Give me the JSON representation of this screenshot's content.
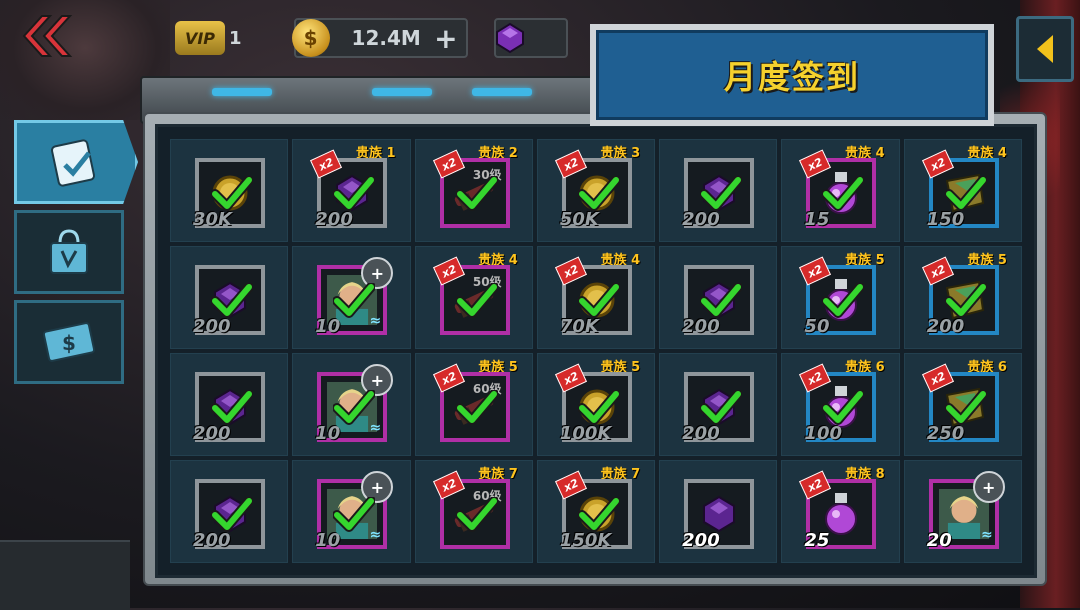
{
  "header": {
    "vip_label": "VIP",
    "vip_level": "1",
    "coin_amount": "12.4M",
    "coin_symbol": "$",
    "plus": "+",
    "title": "月度签到"
  },
  "tabs": [
    {
      "name": "tab-checkin",
      "icon": "calendar-check-icon",
      "active": true
    },
    {
      "name": "tab-shop",
      "icon": "shopping-bag-icon",
      "active": false
    },
    {
      "name": "tab-cash",
      "icon": "cash-icon",
      "active": false
    }
  ],
  "rewards": [
    {
      "qty": "30K",
      "type": "coin",
      "frame": "gray",
      "claimed": true
    },
    {
      "qty": "200",
      "type": "gem",
      "frame": "gray",
      "claimed": true,
      "x2": "x2",
      "noble": "贵族 1"
    },
    {
      "qty": "",
      "type": "weapon",
      "frame": "purple",
      "claimed": true,
      "x2": "x2",
      "noble": "贵族 2",
      "level": "30级"
    },
    {
      "qty": "50K",
      "type": "coin",
      "frame": "gray",
      "claimed": true,
      "x2": "x2",
      "noble": "贵族 3"
    },
    {
      "qty": "200",
      "type": "gem",
      "frame": "gray",
      "claimed": true
    },
    {
      "qty": "15",
      "type": "potion",
      "frame": "purple",
      "claimed": true,
      "x2": "x2",
      "noble": "贵族 4"
    },
    {
      "qty": "150",
      "type": "crystal",
      "frame": "blue",
      "claimed": true,
      "x2": "x2",
      "noble": "贵族 4"
    },
    {
      "qty": "200",
      "type": "gem",
      "frame": "gray",
      "claimed": true
    },
    {
      "qty": "10",
      "type": "hero",
      "frame": "purple",
      "claimed": true,
      "puzzle": "+",
      "wave": "≈"
    },
    {
      "qty": "",
      "type": "weapon",
      "frame": "purple",
      "claimed": true,
      "x2": "x2",
      "noble": "贵族 4",
      "level": "50级"
    },
    {
      "qty": "70K",
      "type": "coin",
      "frame": "gray",
      "claimed": true,
      "x2": "x2",
      "noble": "贵族 4"
    },
    {
      "qty": "200",
      "type": "gem",
      "frame": "gray",
      "claimed": true
    },
    {
      "qty": "50",
      "type": "potion",
      "frame": "blue",
      "claimed": true,
      "x2": "x2",
      "noble": "贵族 5"
    },
    {
      "qty": "200",
      "type": "crystal",
      "frame": "blue",
      "claimed": true,
      "x2": "x2",
      "noble": "贵族 5"
    },
    {
      "qty": "200",
      "type": "gem",
      "frame": "gray",
      "claimed": true
    },
    {
      "qty": "10",
      "type": "hero",
      "frame": "purple",
      "claimed": true,
      "puzzle": "+",
      "wave": "≈"
    },
    {
      "qty": "",
      "type": "weapon",
      "frame": "purple",
      "claimed": true,
      "x2": "x2",
      "noble": "贵族 5",
      "level": "60级"
    },
    {
      "qty": "100K",
      "type": "coin",
      "frame": "gray",
      "claimed": true,
      "x2": "x2",
      "noble": "贵族 5"
    },
    {
      "qty": "200",
      "type": "gem",
      "frame": "gray",
      "claimed": true
    },
    {
      "qty": "100",
      "type": "potion",
      "frame": "blue",
      "claimed": true,
      "x2": "x2",
      "noble": "贵族 6"
    },
    {
      "qty": "250",
      "type": "crystal",
      "frame": "blue",
      "claimed": true,
      "x2": "x2",
      "noble": "贵族 6"
    },
    {
      "qty": "200",
      "type": "gem",
      "frame": "gray",
      "claimed": true
    },
    {
      "qty": "10",
      "type": "hero",
      "frame": "purple",
      "claimed": true,
      "puzzle": "+",
      "wave": "≈"
    },
    {
      "qty": "",
      "type": "weapon",
      "frame": "purple",
      "claimed": true,
      "x2": "x2",
      "noble": "贵族 7",
      "level": "60级"
    },
    {
      "qty": "150K",
      "type": "coin",
      "frame": "gray",
      "claimed": true,
      "x2": "x2",
      "noble": "贵族 7"
    },
    {
      "qty": "200",
      "type": "gem",
      "frame": "gray",
      "claimed": false
    },
    {
      "qty": "25",
      "type": "potion",
      "frame": "purple",
      "claimed": false,
      "x2": "x2",
      "noble": "贵族 8"
    },
    {
      "qty": "20",
      "type": "hero",
      "frame": "purple",
      "claimed": false,
      "puzzle": "+",
      "wave": "≈"
    }
  ],
  "colors": {
    "check": "#35d62e",
    "gold": "#ffc41d",
    "frame_purple": "#b02fa6",
    "frame_blue": "#2387c4"
  }
}
